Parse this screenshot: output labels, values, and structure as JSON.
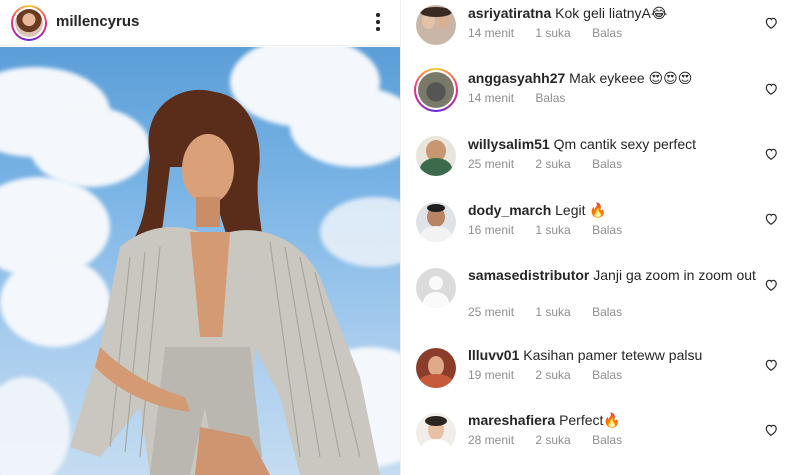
{
  "post": {
    "username": "millencyrus"
  },
  "comments": [
    {
      "user": "asriyatiratna",
      "text": "Kok geli liatnyA😂",
      "time": "14 menit",
      "likes": "1 suka",
      "reply": "Balas"
    },
    {
      "user": "anggasyahh27",
      "text": "Mak eykeee 😍😍😍",
      "time": "14 menit",
      "likes": "",
      "reply": "Balas"
    },
    {
      "user": "willysalim51",
      "text": "Qm cantik sexy perfect",
      "time": "25 menit",
      "likes": "2 suka",
      "reply": "Balas"
    },
    {
      "user": "dody_march",
      "text": "Legit 🔥",
      "time": "16 menit",
      "likes": "1 suka",
      "reply": "Balas"
    },
    {
      "user": "samasedistributor",
      "text": "Janji ga zoom in zoom out",
      "time": "25 menit",
      "likes": "1 suka",
      "reply": "Balas"
    },
    {
      "user": "llluvv01",
      "text": "Kasihan pamer teteww palsu",
      "time": "19 menit",
      "likes": "2 suka",
      "reply": "Balas"
    },
    {
      "user": "mareshafiera",
      "text": "Perfect🔥",
      "time": "28 menit",
      "likes": "2 suka",
      "reply": "Balas"
    }
  ]
}
